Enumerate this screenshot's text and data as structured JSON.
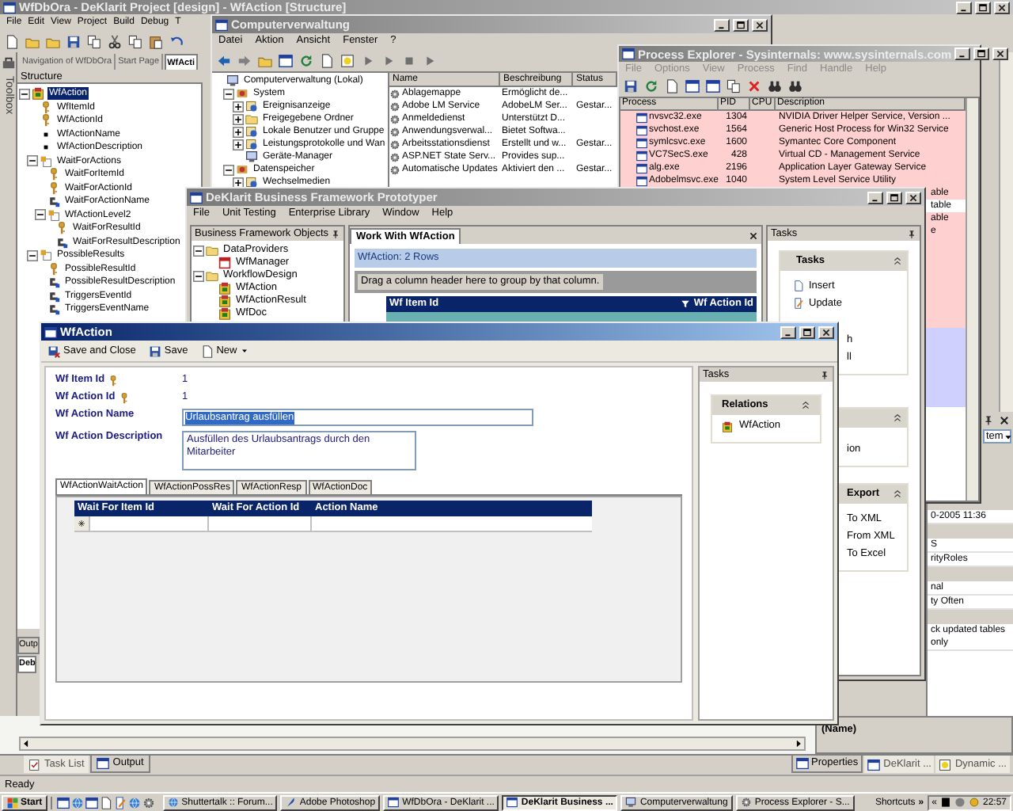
{
  "ide": {
    "title": "WfDbOra - DeKlarit Project [design] - WfAction [Structure]",
    "active": false,
    "menu": [
      "File",
      "Edit",
      "View",
      "Project",
      "Build",
      "Debug",
      "T"
    ],
    "tabs": [
      {
        "label": "Navigation of WfDbOra",
        "selected": false
      },
      {
        "label": "Start Page",
        "selected": false
      },
      {
        "label": "WfActi",
        "selected": true
      }
    ],
    "toolbox": "Toolbox",
    "structure": {
      "header": "Structure",
      "tree": [
        {
          "label": "WfAction",
          "kind": "entity",
          "selected": true,
          "expanded": true,
          "children": [
            {
              "label": "WfItemId",
              "kind": "key",
              "selected": false
            },
            {
              "label": "WfActionId",
              "kind": "key",
              "selected": false
            },
            {
              "label": "WfActionName",
              "kind": "attribute",
              "selected": false
            },
            {
              "label": "WfActionDescription",
              "kind": "attribute",
              "selected": false
            },
            {
              "label": "WaitForActions",
              "kind": "level",
              "selected": false,
              "expanded": true,
              "children": [
                {
                  "label": "WaitForItemId",
                  "kind": "key",
                  "selected": false
                },
                {
                  "label": "WaitForActionId",
                  "kind": "key",
                  "selected": false
                },
                {
                  "label": "WaitForActionName",
                  "kind": "inferred",
                  "selected": false
                },
                {
                  "label": "WfActionLevel2",
                  "kind": "level",
                  "selected": false,
                  "expanded": true,
                  "children": [
                    {
                      "label": "WaitForResultId",
                      "kind": "key",
                      "selected": false
                    },
                    {
                      "label": "WaitForResultDescription",
                      "kind": "inferred",
                      "selected": false
                    }
                  ]
                }
              ]
            },
            {
              "label": "PossibleResults",
              "kind": "level",
              "selected": false,
              "expanded": true,
              "children": [
                {
                  "label": "PossibleResultId",
                  "kind": "key",
                  "selected": false
                },
                {
                  "label": "PossibleResultDescription",
                  "kind": "inferred",
                  "selected": false
                },
                {
                  "label": "TriggersEventId",
                  "kind": "inferred",
                  "selected": false
                },
                {
                  "label": "TriggersEventName",
                  "kind": "inferred",
                  "selected": false
                }
              ]
            }
          ]
        }
      ]
    },
    "output_tabs": [
      "Outp",
      "Deb"
    ],
    "combo": "tem",
    "property_grid": [
      {
        "kind": "value",
        "text": "0-2005 11:36"
      },
      {
        "kind": "category"
      },
      {
        "kind": "value",
        "text": "S"
      },
      {
        "kind": "value",
        "text": "rityRoles"
      },
      {
        "kind": "category"
      },
      {
        "kind": "value",
        "text": "nal"
      },
      {
        "kind": "value",
        "text": "ty Often"
      },
      {
        "kind": "category"
      },
      {
        "kind": "value",
        "text": "ck updated tables only"
      }
    ],
    "property_name": "(Name)",
    "bottom_tabs": [
      {
        "label": "Task List",
        "selected": false
      },
      {
        "label": "Output",
        "selected": true
      }
    ],
    "side_tabs": [
      {
        "label": "Properties",
        "selected": true
      },
      {
        "label": "DeKlarit ...",
        "selected": false
      },
      {
        "label": "Dynamic ...",
        "selected": false
      }
    ],
    "status": "Ready"
  },
  "computer_management": {
    "title": "Computerverwaltung",
    "active": false,
    "menu": [
      "Datei",
      "Aktion",
      "Ansicht",
      "Fenster",
      "?"
    ],
    "tree": [
      {
        "label": "Computerverwaltung (Lokal)",
        "kind": "computer",
        "children": [
          {
            "label": "System",
            "kind": "tools",
            "expanded": true,
            "children": [
              {
                "label": "Ereignisanzeige",
                "kind": "snapin",
                "expanded": false
              },
              {
                "label": "Freigegebene Ordner",
                "kind": "folder",
                "expanded": false
              },
              {
                "label": "Lokale Benutzer und Gruppe",
                "kind": "snapin",
                "expanded": false
              },
              {
                "label": "Leistungsprotokolle und Wan",
                "kind": "snapin",
                "expanded": false
              },
              {
                "label": "Geräte-Manager",
                "kind": "computer"
              }
            ]
          },
          {
            "label": "Datenspeicher",
            "kind": "tools",
            "expanded": true,
            "children": [
              {
                "label": "Wechselmedien",
                "kind": "snapin",
                "expanded": false
              }
            ]
          }
        ]
      }
    ],
    "columns": [
      "Name",
      "Beschreibung",
      "Status"
    ],
    "rows": [
      {
        "name": "Ablagemappe",
        "description": "Ermöglicht de..."
      },
      {
        "name": "Adobe LM Service",
        "description": "AdobeLM Ser...",
        "status": "Gestar..."
      },
      {
        "name": "Anmeldedienst",
        "description": "Unterstützt D..."
      },
      {
        "name": "Anwendungsverwal...",
        "description": "Bietet Softwa..."
      },
      {
        "name": "Arbeitsstationsdienst",
        "description": "Erstellt und w...",
        "status": "Gestar..."
      },
      {
        "name": "ASP.NET State Serv...",
        "description": "Provides sup..."
      },
      {
        "name": "Automatische Updates",
        "description": "Aktiviert den ...",
        "status": "Gestar..."
      }
    ]
  },
  "process_explorer": {
    "title": "Process Explorer - Sysinternals: www.sysinternals.com",
    "active": false,
    "menu": [
      "File",
      "Options",
      "View",
      "Process",
      "Find",
      "Handle",
      "Help"
    ],
    "columns": [
      "Process",
      "PID",
      "CPU",
      "Description"
    ],
    "rows": [
      {
        "process": "nvsvc32.exe",
        "pid": "1304",
        "description": "NVIDIA Driver Helper Service, Version ...",
        "kind": "service"
      },
      {
        "process": "svchost.exe",
        "pid": "1564",
        "description": "Generic Host Process for Win32 Service",
        "kind": "service"
      },
      {
        "process": "symlcsvc.exe",
        "pid": "1600",
        "description": "Symantec Core Component",
        "kind": "service"
      },
      {
        "process": "VC7SecS.exe",
        "pid": "428",
        "description": "Virtual CD - Management Service",
        "kind": "service"
      },
      {
        "process": "alg.exe",
        "pid": "2196",
        "description": "Application Layer Gateway Service",
        "kind": "service"
      },
      {
        "process": "Adobelmsvc.exe",
        "pid": "1040",
        "description": "System Level Service Utility",
        "kind": "service"
      }
    ],
    "fragments": [
      {
        "text": "able",
        "kind": "service"
      },
      {
        "text": "table",
        "kind": "own"
      },
      {
        "text": "able",
        "kind": "service"
      },
      {
        "text": "e",
        "kind": "service"
      }
    ]
  },
  "prototyper": {
    "title": "DeKlarit Business Framework Prototyper",
    "active": false,
    "menu": [
      "File",
      "Unit Testing",
      "Enterprise Library",
      "Window",
      "Help"
    ],
    "objects_header": "Business Framework Objects",
    "objects_tree": [
      {
        "label": "DataProviders",
        "kind": "folder",
        "expanded": true,
        "children": [
          {
            "label": "WfManager",
            "kind": "provider"
          }
        ]
      },
      {
        "label": "WorkflowDesign",
        "kind": "folder",
        "expanded": true,
        "children": [
          {
            "label": "WfAction",
            "kind": "entity"
          },
          {
            "label": "WfActionResult",
            "kind": "entity"
          },
          {
            "label": "WfDoc",
            "kind": "entity"
          }
        ]
      }
    ],
    "document_tab": "Work With WfAction",
    "grid_caption": "WfAction: 2 Rows",
    "group_hint": "Drag a column header here to group by that column.",
    "columns": [
      {
        "label": "Wf Item Id",
        "filtered": false
      },
      {
        "label": "Wf Action Id",
        "filtered": true
      }
    ],
    "tasks_header": "Tasks",
    "task_groups": [
      {
        "title": "Tasks",
        "kind": "full",
        "items": [
          {
            "label": "Insert",
            "kind": "insert"
          },
          {
            "label": "Update",
            "kind": "update"
          },
          {
            "label": "h",
            "kind": "cut"
          },
          {
            "label": "ll",
            "kind": "cut"
          }
        ]
      },
      {
        "kind": "cut",
        "items": [
          {
            "label": "ion",
            "kind": "cut"
          }
        ]
      },
      {
        "title": "Export",
        "kind": "cut",
        "items": [
          {
            "label": "To XML",
            "kind": "cut"
          },
          {
            "label": "From XML",
            "kind": "cut"
          },
          {
            "label": "To Excel",
            "kind": "cut"
          }
        ]
      }
    ]
  },
  "dialog": {
    "title": "WfAction",
    "active": true,
    "toolbar": [
      {
        "label": "Save and Close",
        "kind": "save-close"
      },
      {
        "label": "Save",
        "kind": "save"
      },
      {
        "label": "New",
        "kind": "new",
        "dropdown": true
      }
    ],
    "fields": [
      {
        "label": "Wf Item Id",
        "kind": "readonly",
        "key": true,
        "value": "1"
      },
      {
        "label": "Wf Action Id",
        "kind": "readonly",
        "key": true,
        "value": "1"
      },
      {
        "label": "Wf Action Name",
        "kind": "input",
        "value": "Urlaubsantrag ausfüllen",
        "highlighted": true
      },
      {
        "label": "Wf Action Description",
        "kind": "textarea",
        "value": "Ausfüllen des Urlaubsantrags durch den Mitarbeiter"
      }
    ],
    "tabs": [
      {
        "label": "WfActionWaitAction",
        "selected": true
      },
      {
        "label": "WfActionPossRes",
        "selected": false
      },
      {
        "label": "WfActionResp",
        "selected": false
      },
      {
        "label": "WfActionDoc",
        "selected": false
      }
    ],
    "grid_columns": [
      "Wait For Item Id",
      "Wait For Action Id",
      "Action Name"
    ],
    "tasks_header": "Tasks",
    "relations": {
      "title": "Relations",
      "items": [
        "WfAction"
      ]
    }
  },
  "taskbar": {
    "start": "Start",
    "buttons": [
      {
        "label": "Shuttertalk :: Forum...",
        "kind": "browser",
        "selected": false
      },
      {
        "label": "Adobe Photoshop",
        "kind": "photoshop",
        "selected": false
      },
      {
        "label": "WfDbOra - DeKlarit ...",
        "kind": "studio",
        "selected": false
      },
      {
        "label": "DeKlarit Business ...",
        "kind": "app",
        "selected": true
      },
      {
        "label": "Computerverwaltung",
        "kind": "computer",
        "selected": false
      },
      {
        "label": "Process Explorer - S...",
        "kind": "process",
        "selected": false
      }
    ],
    "shortcuts": "Shortcuts",
    "more": "»",
    "collapse": "«",
    "clock": "22:57"
  }
}
